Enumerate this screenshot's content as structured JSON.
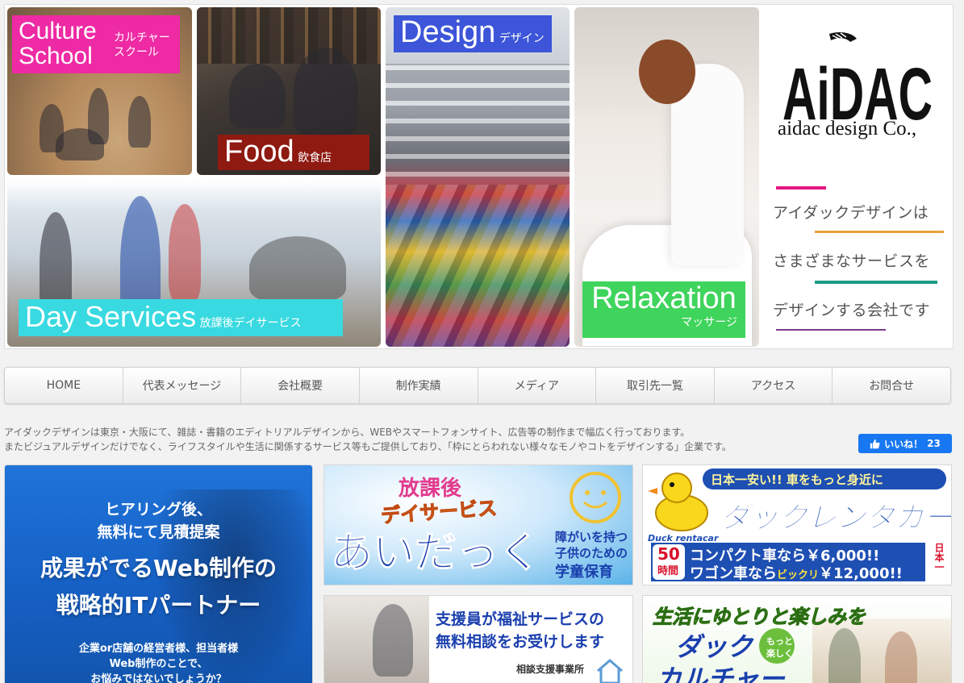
{
  "hero": {
    "culture": {
      "en_line1": "Culture",
      "en_line2": "School",
      "jp_line1": "カルチャー",
      "jp_line2": "スクール",
      "color": "#ee2aa4"
    },
    "food": {
      "en": "Food",
      "jp": "飲食店",
      "color": "#8e1a12"
    },
    "design": {
      "en": "Design",
      "jp": "デザイン",
      "color": "#3d55d8"
    },
    "day": {
      "en": "Day Services",
      "jp": "放課後デイサービス",
      "color": "#38d9e0"
    },
    "relax": {
      "en": "Relaxation",
      "jp": "マッサージ",
      "color": "#3fd45c"
    },
    "brand": {
      "logo": "AiDAC",
      "company": "aidac design Co.,",
      "tagline": [
        "アイダックデザインは",
        "さまざまなサービスを",
        "デザインする会社です"
      ],
      "bar_colors": [
        "#e2177f",
        "#e8a23a",
        "#1a9b86",
        "#7a3a8a"
      ]
    }
  },
  "nav": {
    "items": [
      "HOME",
      "代表メッセージ",
      "会社概要",
      "制作実績",
      "メディア",
      "取引先一覧",
      "アクセス",
      "お問合せ"
    ]
  },
  "intro": {
    "line1": "アイダックデザインは東京・大阪にて、雑誌・書籍のエディトリアルデザインから、WEBやスマートフォンサイト、広告等の制作まで幅広く行っております。",
    "line2": "またビジュアルデザインだけでなく、ライフスタイルや生活に関係するサービス等もご提供しており、「枠にとらわれない様々なモノやコトをデザインする」企業です。"
  },
  "facebook": {
    "label": "いいね！",
    "count": "23",
    "icon": "thumbs-up-icon"
  },
  "banners": {
    "web": {
      "line1": "ヒアリング後、",
      "line2": "無料にて見積提案",
      "line3": "成果がでるWeb制作の",
      "line4": "戦略的ITパートナー",
      "line5": "企業or店舗の経営者様、担当者様",
      "line6": "Web制作のことで、",
      "line7": "お悩みではないでしょうか？"
    },
    "aidakku": {
      "top": "放課後",
      "mid": "デイサービス",
      "main": "あいだっく",
      "sub1": "障がいを持つ",
      "sub2": "子供のための",
      "sub3": "学童保育"
    },
    "duck": {
      "top": "日本一安い!! 車をもっと身近に",
      "logo_small": "Duck rentacar",
      "name": "ダックレンタカー",
      "badge_num": "50",
      "badge_unit": "時間",
      "line1": "コンパクト車なら￥6,000!!",
      "line2_a": "ワゴン車なら",
      "line2_b": "ビックリ",
      "line2_c": "￥12,000!!",
      "side": "日本一"
    },
    "sodan": {
      "line1": "支援員が福祉サービスの",
      "line2": "無料相談をお受けします",
      "line3": "相談支援事業所"
    },
    "culture": {
      "line1": "生活にゆとりと楽しみを",
      "line2": "ダック",
      "line3": "カルチャー",
      "bubble1": "もっと",
      "bubble2": "楽しく"
    }
  }
}
